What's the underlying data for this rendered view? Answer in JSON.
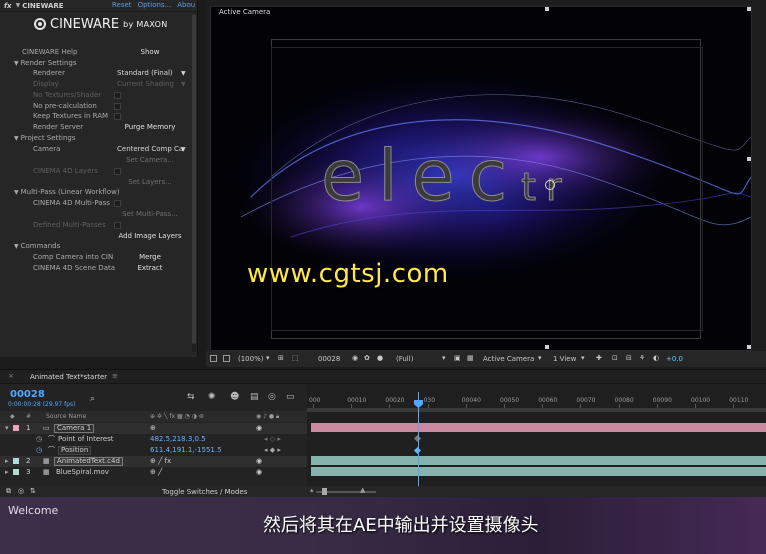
{
  "effect_controls": {
    "fx_title": "CINEWARE",
    "reset": "Reset",
    "options": "Options...",
    "about": "Abou",
    "logo_main": "CINEWARE",
    "logo_by": "by MAXON",
    "rows": {
      "help_label": "CINEWARE Help",
      "help_btn": "Show",
      "render_settings": "Render Settings",
      "renderer_label": "Renderer",
      "renderer_val": "Standard (Final)",
      "display_label": "Display",
      "display_val": "Current Shading",
      "no_textures": "No Textures/Shader",
      "no_precalc": "No pre-calculation",
      "keep_textures": "Keep Textures in RAM",
      "render_server": "Render Server",
      "purge_memory": "Purge Memory",
      "project_settings": "Project Settings",
      "camera_label": "Camera",
      "camera_val": "Centered Comp Ca",
      "set_camera": "Set Camera...",
      "c4d_layers": "CINEMA 4D Layers",
      "set_layers": "Set Layers...",
      "multipass": "Multi-Pass (Linear Workflow)",
      "c4d_multipass": "CINEMA 4D Multi-Pass",
      "set_multipass": "Set Multi-Pass...",
      "defined_multipasses": "Defined Multi-Passes",
      "add_image_layers": "Add Image Layers",
      "commands": "Commands",
      "comp_camera": "Comp Camera into CIN",
      "merge": "Merge",
      "scene_data": "CINEMA 4D Scene Data",
      "extract": "Extract"
    }
  },
  "viewer": {
    "label": "Active Camera",
    "scene_text_big": "elec",
    "scene_text_small": "tr",
    "watermark": "www.cgtsj.com",
    "zoom": "(100%)",
    "frame": "00028",
    "resolution": "(Full)",
    "camera_menu": "Active Camera",
    "view_menu": "1 View",
    "exposure": "+0.0"
  },
  "timeline": {
    "tab": "Animated Text*starter",
    "timecode": "00028",
    "fps_line": "0:00:00:28 (29.97 fps)",
    "col_source": "Source Name",
    "col_num": "#",
    "layers": [
      {
        "num": "1",
        "name": "Camera 1",
        "color": "#e7a9b9"
      },
      {
        "num": "2",
        "name": "AnimatedText.c4d",
        "color": "#b5d9d6"
      },
      {
        "num": "3",
        "name": "BlueSpiral.mov",
        "color": "#b5d9d6"
      }
    ],
    "props": [
      {
        "name": "Point of Interest",
        "value": "482.5,218.3,0.5"
      },
      {
        "name": "Position",
        "value": "611.4,191.1,-1551.5"
      }
    ],
    "ruler": [
      "000",
      "00010",
      "00020",
      "030",
      "00040",
      "00050",
      "00060",
      "00070",
      "00080",
      "00090",
      "00100",
      "00110"
    ],
    "toggle": "Toggle Switches / Modes",
    "playhead_frame": 28
  },
  "footer": {
    "welcome": "Welcome",
    "subtitle": "然后将其在AE中输出并设置摄像头"
  },
  "colors": {
    "accent_blue": "#4fa8ff",
    "camera_bar": "#c98aa0",
    "layer_bar": "#86b3ad",
    "watermark": "#ffe84a"
  }
}
